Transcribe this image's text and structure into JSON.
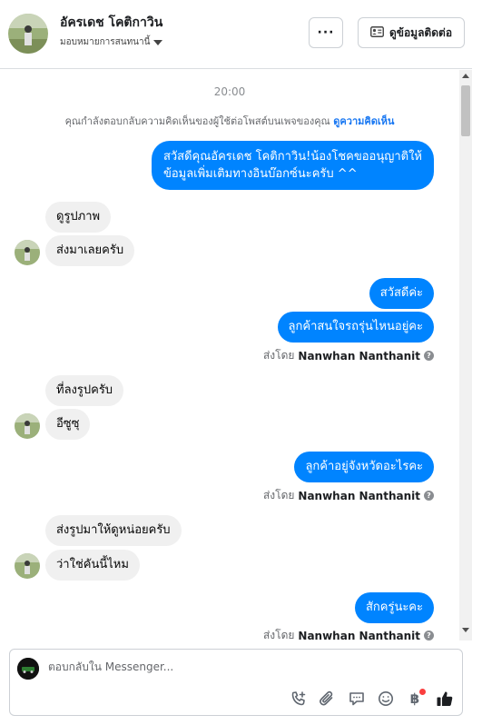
{
  "header": {
    "contact_name": "อัครเดช โคติกาวิน",
    "assign_label": "มอบหมายการสนทนานี้",
    "more_label": "···",
    "contact_info_label": "ดูข้อมูลติดต่อ"
  },
  "thread": {
    "timestamp": "20:00",
    "notice_text": "คุณกำลังตอบกลับความคิดเห็นของผู้ใช้ต่อโพสต์บนเพจของคุณ ",
    "notice_link": "ดูความคิดเห็น",
    "messages": [
      {
        "from": "page",
        "lines": [
          "สวัสดีคุณอัครเดช โคติกาวิน!น้องโชคขออนุญาติให้",
          "ข้อมูลเพิ่มเติมทางอินบ๊อกซ์นะครับ ^^"
        ]
      },
      {
        "from": "user",
        "text": "ดูรูปภาพ"
      },
      {
        "from": "user",
        "text": "ส่งมาเลยครับ"
      },
      {
        "from": "page",
        "text": "สวัสดีค่ะ"
      },
      {
        "from": "page",
        "text": "ลูกค้าสนใจรถรุ่นไหนอยู่คะ"
      },
      {
        "from": "user",
        "text": "ที่ลงรูปครับ"
      },
      {
        "from": "user",
        "text": "อีซูซุ"
      },
      {
        "from": "page",
        "text": "ลูกค้าอยู่จังหวัดอะไรคะ"
      },
      {
        "from": "user",
        "text": "ส่งรูปมาให้ดูหน่อยครับ"
      },
      {
        "from": "user",
        "text": "ว่าใช่คันนี้ไหม"
      },
      {
        "from": "page",
        "text": "สักครู่นะคะ"
      }
    ],
    "sent_by_prefix": "ส่งโดย",
    "sent_by_name": "Nanwhan Nanthanit",
    "info_mark": "?"
  },
  "composer": {
    "placeholder": "ตอบกลับใน Messenger...",
    "baht_symbol": "฿"
  },
  "colors": {
    "outgoing_bubble": "#0084ff",
    "incoming_bubble": "#f0f0f0",
    "link": "#1877f2",
    "notification_dot": "#fa3e3e"
  }
}
